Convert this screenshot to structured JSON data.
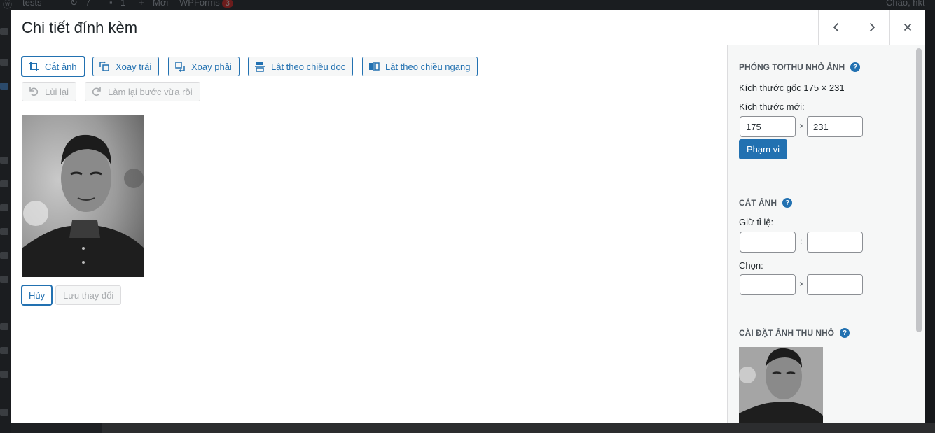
{
  "admin_bar": {
    "site": "tests",
    "updates": "7",
    "comments": "1",
    "new": "Mới",
    "wpforms": "WPForms",
    "wpforms_count": "3",
    "greeting": "Chào, hkt"
  },
  "modal": {
    "title": "Chi tiết đính kèm",
    "prev_icon": "chevron-left-icon",
    "next_icon": "chevron-right-icon",
    "close_icon": "close-icon"
  },
  "toolbar": {
    "crop": "Cắt ảnh",
    "rotate_left": "Xoay trái",
    "rotate_right": "Xoay phải",
    "flip_vertical": "Lật theo chiều dọc",
    "flip_horizontal": "Lật theo chiều ngang",
    "undo": "Lùi lại",
    "redo": "Làm lại bước vừa rồi"
  },
  "actions": {
    "cancel": "Hủy",
    "save": "Lưu thay đổi"
  },
  "scale": {
    "heading": "PHÓNG TO/THU NHỎ ẢNH",
    "original": "Kích thước gốc 175 × 231",
    "new_label": "Kích thước mới:",
    "width": "175",
    "height": "231",
    "separator": "×",
    "button": "Phạm vi"
  },
  "crop": {
    "heading": "CẮT ẢNH",
    "ratio_label": "Giữ tỉ lệ:",
    "ratio_separator": ":",
    "selection_label": "Chọn:",
    "selection_separator": "×"
  },
  "thumbnail": {
    "heading": "CÀI ĐẶT ẢNH THU NHỎ"
  },
  "colors": {
    "accent": "#2271b1",
    "border": "#dcdcde",
    "sidebar_bg": "#f6f7f7"
  }
}
